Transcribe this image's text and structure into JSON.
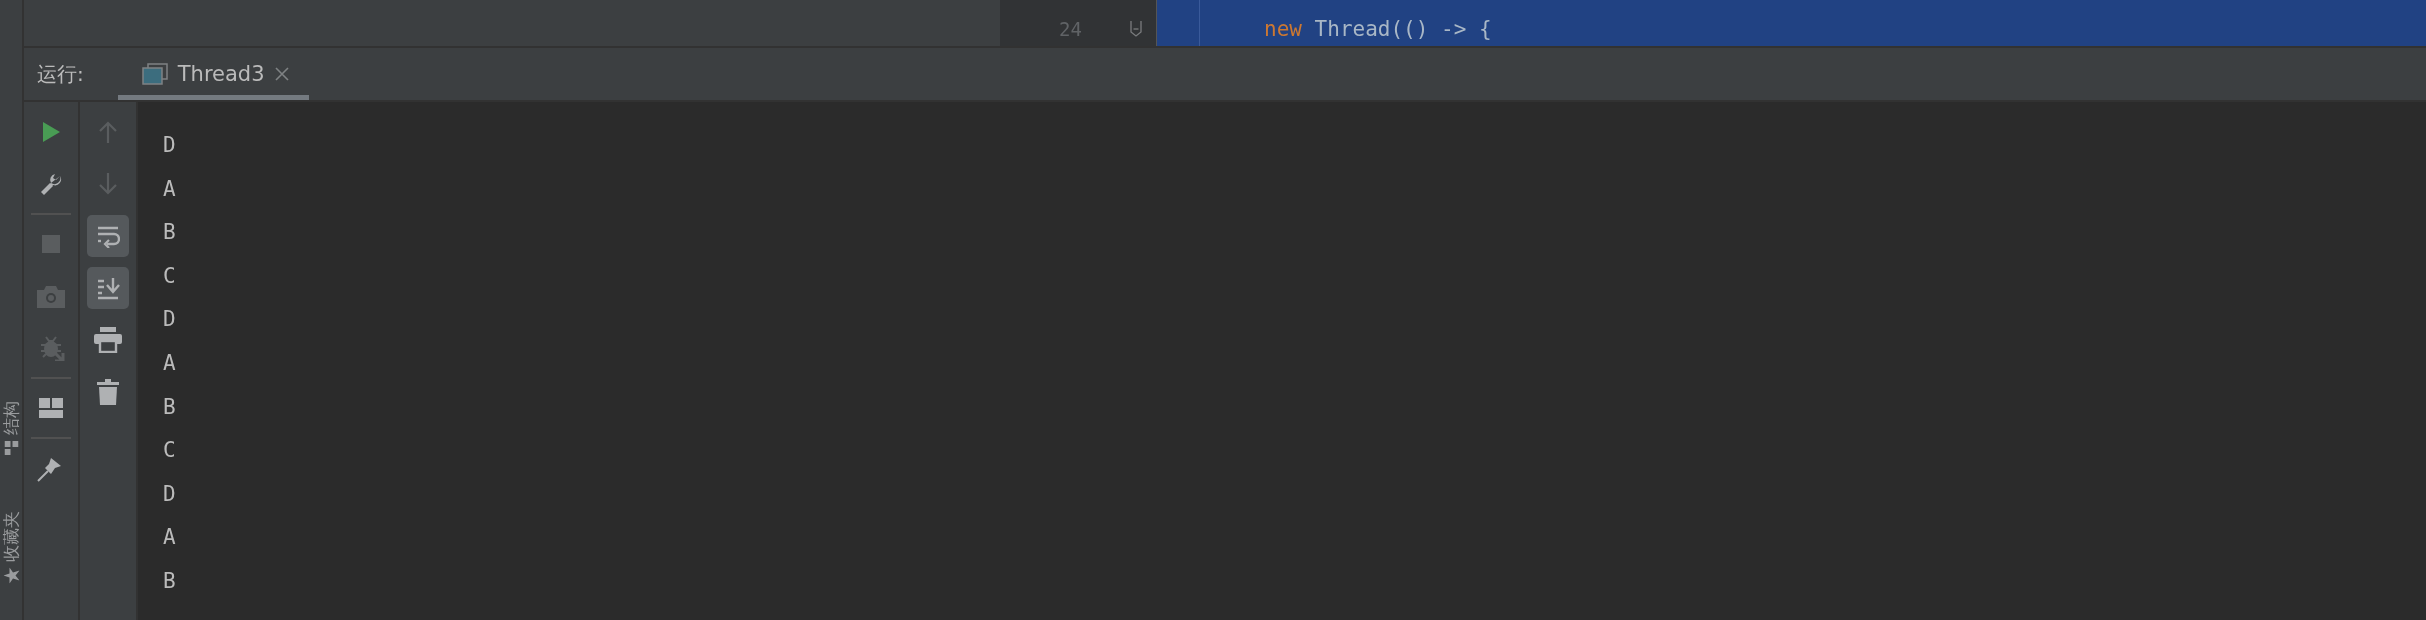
{
  "editor": {
    "line_number": "24",
    "code": [
      {
        "text": "new",
        "kind": "keyword"
      },
      {
        "text": "Thread(() -> {",
        "kind": "plain"
      }
    ]
  },
  "run_panel": {
    "label": "运行:",
    "tabs": [
      {
        "label": "Thread3",
        "selected": true
      }
    ]
  },
  "side_stripe": [
    {
      "label": "结构",
      "kind": "structure"
    },
    {
      "label": "收藏夹",
      "kind": "favorites"
    }
  ],
  "run_toolbar": [
    {
      "kind": "run",
      "disabled": false
    },
    {
      "kind": "wrench",
      "disabled": false
    },
    {
      "kind": "separator"
    },
    {
      "kind": "stop",
      "disabled": true
    },
    {
      "kind": "camera",
      "disabled": true
    },
    {
      "kind": "bug",
      "disabled": true
    },
    {
      "kind": "separator"
    },
    {
      "kind": "layout",
      "disabled": false
    },
    {
      "kind": "separator"
    },
    {
      "kind": "pin",
      "disabled": false
    }
  ],
  "console_toolbar": [
    {
      "kind": "up",
      "on": false,
      "disabled": true
    },
    {
      "kind": "down",
      "on": false,
      "disabled": true
    },
    {
      "kind": "wrap",
      "on": true,
      "disabled": false
    },
    {
      "kind": "scroll",
      "on": true,
      "disabled": false
    },
    {
      "kind": "print",
      "on": false,
      "disabled": false
    },
    {
      "kind": "trash",
      "on": false,
      "disabled": false
    }
  ],
  "console": {
    "lines": [
      "D",
      "A",
      "B",
      "C",
      "D",
      "A",
      "B",
      "C",
      "D",
      "A",
      "B"
    ]
  }
}
